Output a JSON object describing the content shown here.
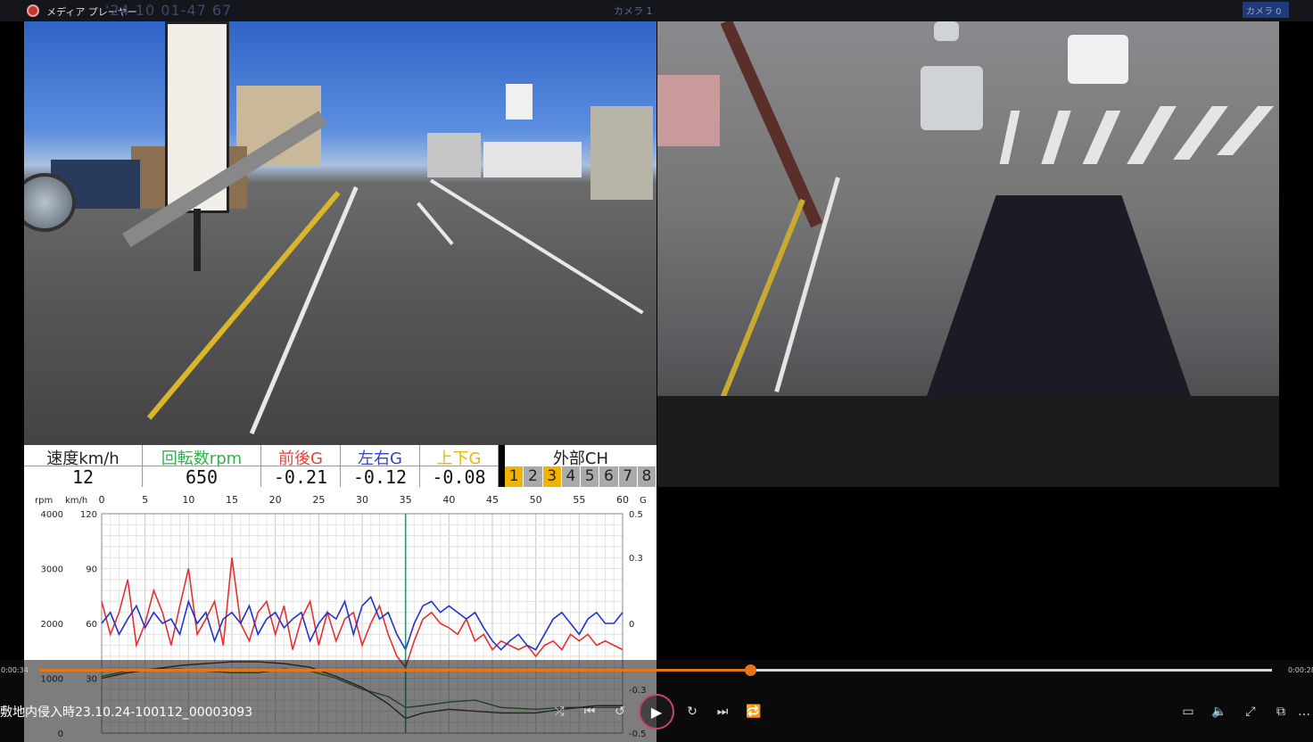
{
  "window": {
    "title": "メディア プレーヤー",
    "ghost_timestamp": "'24 10 01-47 67",
    "camera_label_left": "カメラ 1",
    "camera_label_right": "カメラ 0"
  },
  "telemetry": {
    "speed": {
      "label": "速度km/h",
      "value": "12",
      "color": "#222222"
    },
    "rpm": {
      "label": "回転数rpm",
      "value": "650",
      "color": "#2db34a"
    },
    "fb_g": {
      "label": "前後G",
      "value": "-0.21",
      "color": "#e0443a"
    },
    "lr_g": {
      "label": "左右G",
      "value": "-0.12",
      "color": "#3344cc"
    },
    "ud_g": {
      "label": "上下G",
      "value": "-0.08",
      "color": "#e6b800"
    }
  },
  "external_ch": {
    "label": "外部CH",
    "channels": [
      "1",
      "2",
      "3",
      "4",
      "5",
      "6",
      "7",
      "8"
    ],
    "active": [
      0,
      2
    ]
  },
  "chart_data": {
    "type": "line",
    "axis_units": {
      "left_outer": "rpm",
      "left_inner": "km/h",
      "right": "G"
    },
    "x_ticks": [
      "0",
      "5",
      "10",
      "15",
      "20",
      "25",
      "30",
      "35",
      "40",
      "45",
      "50",
      "55",
      "60"
    ],
    "rpm_ticks": [
      "4000",
      "3000",
      "2000",
      "1000",
      "0"
    ],
    "kmh_ticks": [
      "120",
      "90",
      "60",
      "30"
    ],
    "g_ticks": [
      "0.5",
      "0.3",
      "0",
      "-0.3",
      "-0.5"
    ],
    "xlim": [
      0,
      60
    ],
    "g_ylim": [
      -0.5,
      0.5
    ],
    "kmh_ylim": [
      0,
      120
    ],
    "cursor_x": 35,
    "grid": true,
    "series": [
      {
        "color": "#e53030",
        "x": [
          0,
          1,
          2,
          3,
          4,
          5,
          6,
          7,
          8,
          9,
          10,
          11,
          12,
          13,
          14,
          15,
          16,
          17,
          18,
          19,
          20,
          21,
          22,
          23,
          24,
          25,
          26,
          27,
          28,
          29,
          30,
          31,
          32,
          33,
          34,
          35,
          36,
          37,
          38,
          39,
          40,
          41,
          42,
          43,
          44,
          45,
          46,
          47,
          48,
          49,
          50,
          51,
          52,
          53,
          54,
          55,
          56,
          57,
          58,
          59,
          60
        ],
        "y": [
          0.1,
          -0.05,
          0.05,
          0.2,
          -0.1,
          0.0,
          0.15,
          0.05,
          -0.1,
          0.08,
          0.25,
          -0.05,
          0.02,
          0.1,
          -0.1,
          0.3,
          0.0,
          -0.08,
          0.05,
          0.1,
          -0.05,
          0.08,
          -0.12,
          0.02,
          0.1,
          -0.1,
          0.05,
          -0.08,
          0.02,
          0.05,
          -0.1,
          0.0,
          0.08,
          -0.05,
          -0.15,
          -0.2,
          -0.08,
          0.02,
          0.05,
          0.0,
          -0.02,
          -0.05,
          0.02,
          -0.08,
          -0.05,
          -0.12,
          -0.08,
          -0.1,
          -0.12,
          -0.1,
          -0.15,
          -0.1,
          -0.08,
          -0.12,
          -0.05,
          -0.08,
          -0.05,
          -0.1,
          -0.08,
          -0.1,
          -0.12
        ]
      },
      {
        "color": "#2233cc",
        "x": [
          0,
          1,
          2,
          3,
          4,
          5,
          6,
          7,
          8,
          9,
          10,
          11,
          12,
          13,
          14,
          15,
          16,
          17,
          18,
          19,
          20,
          21,
          22,
          23,
          24,
          25,
          26,
          27,
          28,
          29,
          30,
          31,
          32,
          33,
          34,
          35,
          36,
          37,
          38,
          39,
          40,
          41,
          42,
          43,
          44,
          45,
          46,
          47,
          48,
          49,
          50,
          51,
          52,
          53,
          54,
          55,
          56,
          57,
          58,
          59,
          60
        ],
        "y": [
          0.0,
          0.05,
          -0.05,
          0.02,
          0.08,
          -0.02,
          0.05,
          0.0,
          0.02,
          -0.05,
          0.1,
          0.0,
          0.05,
          -0.08,
          0.02,
          0.05,
          0.0,
          0.08,
          -0.05,
          0.02,
          0.05,
          -0.02,
          0.02,
          0.05,
          -0.08,
          0.0,
          0.05,
          0.02,
          0.1,
          -0.05,
          0.08,
          0.12,
          0.02,
          0.05,
          -0.05,
          -0.12,
          0.0,
          0.08,
          0.1,
          0.05,
          0.08,
          0.05,
          0.02,
          0.05,
          -0.02,
          -0.08,
          -0.12,
          -0.08,
          -0.05,
          -0.1,
          -0.12,
          -0.05,
          0.02,
          0.05,
          0.0,
          -0.05,
          0.02,
          0.05,
          0.0,
          0.0,
          0.05
        ]
      },
      {
        "color": "#2d7d2d",
        "x": [
          0,
          3,
          6,
          9,
          12,
          15,
          18,
          21,
          24,
          27,
          30,
          33,
          35,
          37,
          40,
          43,
          46,
          50,
          53,
          57,
          60
        ],
        "y": [
          31,
          34,
          35,
          35,
          34,
          33,
          33,
          35,
          34,
          30,
          24,
          20,
          14,
          15,
          17,
          18,
          14,
          13,
          14,
          14,
          14
        ]
      },
      {
        "color": "#333333",
        "x": [
          0,
          3,
          6,
          9,
          12,
          15,
          18,
          21,
          24,
          27,
          30,
          33,
          35,
          37,
          40,
          43,
          46,
          50,
          53,
          57,
          60
        ],
        "y": [
          30,
          33,
          35,
          37,
          38,
          39,
          39,
          38,
          36,
          31,
          25,
          16,
          8,
          11,
          13,
          12,
          11,
          11,
          13,
          15,
          15
        ]
      }
    ]
  },
  "seek": {
    "time_current": "0:00:34",
    "time_total": "0:00:28",
    "progress": 0.577
  },
  "file_name": "敷地内侵入時23.10.24-100112_00003093",
  "icons": {
    "shuffle": "⤮",
    "prev": "⏮",
    "rewind": "↺",
    "play": "▶",
    "forward": "↻",
    "next": "⏭",
    "repeat": "🔁",
    "miniplayer": "▭",
    "volume": "🔈",
    "fullscreen": "⤢",
    "cast": "⧉",
    "more": "…"
  }
}
